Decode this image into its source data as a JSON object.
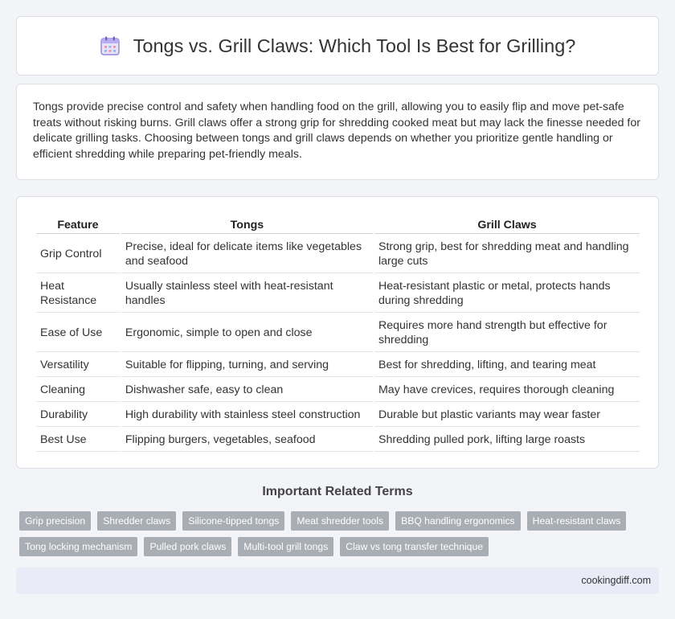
{
  "header": {
    "title": "Tongs vs. Grill Claws: Which Tool Is Best for Grilling?",
    "icon": "calendar-icon"
  },
  "intro": {
    "text": "Tongs provide precise control and safety when handling food on the grill, allowing you to easily flip and move pet-safe treats without risking burns. Grill claws offer a strong grip for shredding cooked meat but may lack the finesse needed for delicate grilling tasks. Choosing between tongs and grill claws depends on whether you prioritize gentle handling or efficient shredding while preparing pet-friendly meals."
  },
  "table": {
    "headers": [
      "Feature",
      "Tongs",
      "Grill Claws"
    ],
    "rows": [
      [
        "Grip Control",
        "Precise, ideal for delicate items like vegetables and seafood",
        "Strong grip, best for shredding meat and handling large cuts"
      ],
      [
        "Heat Resistance",
        "Usually stainless steel with heat-resistant handles",
        "Heat-resistant plastic or metal, protects hands during shredding"
      ],
      [
        "Ease of Use",
        "Ergonomic, simple to open and close",
        "Requires more hand strength but effective for shredding"
      ],
      [
        "Versatility",
        "Suitable for flipping, turning, and serving",
        "Best for shredding, lifting, and tearing meat"
      ],
      [
        "Cleaning",
        "Dishwasher safe, easy to clean",
        "May have crevices, requires thorough cleaning"
      ],
      [
        "Durability",
        "High durability with stainless steel construction",
        "Durable but plastic variants may wear faster"
      ],
      [
        "Best Use",
        "Flipping burgers, vegetables, seafood",
        "Shredding pulled pork, lifting large roasts"
      ]
    ]
  },
  "related": {
    "heading": "Important Related Terms",
    "tags": [
      "Grip precision",
      "Shredder claws",
      "Silicone-tipped tongs",
      "Meat shredder tools",
      "BBQ handling ergonomics",
      "Heat-resistant claws",
      "Tong locking mechanism",
      "Pulled pork claws",
      "Multi-tool grill tongs",
      "Claw vs tong transfer technique"
    ]
  },
  "footer": {
    "text": "cookingdiff.com"
  }
}
